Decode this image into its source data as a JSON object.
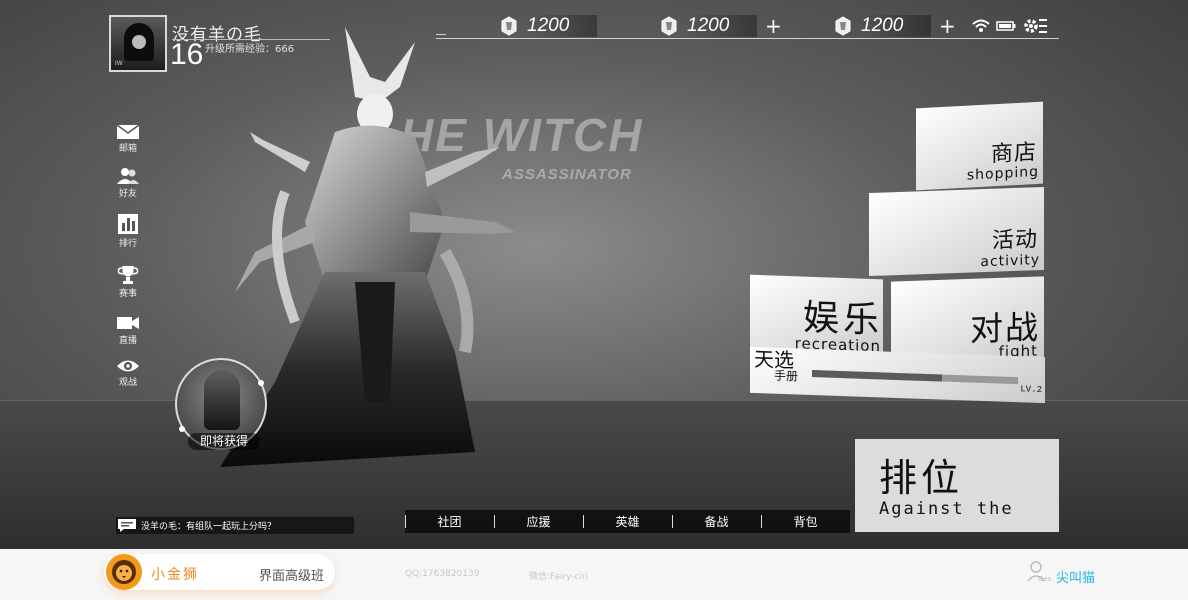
{
  "player": {
    "name": "没有羊の毛",
    "level": "16",
    "exp_label": "升级所需经验：666",
    "avatar_tag": "IW"
  },
  "currencies": [
    {
      "amount": "1200",
      "has_add": false
    },
    {
      "amount": "1200",
      "has_add": true,
      "add_label": "+"
    },
    {
      "amount": "1200",
      "has_add": true,
      "add_label": "+"
    }
  ],
  "system_icons": [
    "wifi-icon",
    "battery-icon",
    "settings-icon"
  ],
  "sidebar": {
    "items": [
      {
        "label": "邮箱",
        "icon": "mail-icon"
      },
      {
        "label": "好友",
        "icon": "friends-icon"
      },
      {
        "label": "排行",
        "icon": "ranking-icon"
      },
      {
        "label": "赛事",
        "icon": "trophy-icon"
      },
      {
        "label": "直播",
        "icon": "live-camera-icon"
      },
      {
        "label": "观战",
        "icon": "eye-icon"
      }
    ]
  },
  "hero": {
    "title": "HE WITCH",
    "subtitle": "ASSASSINATOR"
  },
  "reward": {
    "label": "即将获得"
  },
  "menu": {
    "shop": {
      "cn": "商店",
      "en": "shopping"
    },
    "activity": {
      "cn": "活动",
      "en": "activity"
    },
    "recreation": {
      "cn": "娱乐",
      "en": "recreation"
    },
    "fight": {
      "cn": "对战",
      "en": "fight"
    },
    "pass": {
      "cn_title": "天选",
      "cn_sub": "手册",
      "level": "LV.2",
      "progress": 0.63
    },
    "ranked": {
      "cn": "排位",
      "en": "Against the"
    }
  },
  "bottom_nav": [
    "社团",
    "应援",
    "英雄",
    "备战",
    "背包"
  ],
  "chat": {
    "text": "没羊の毛：有组队一起玩上分吗？"
  },
  "footer": {
    "brand": "小金狮",
    "course": "界面高级班",
    "qq": "QQ:1763820139",
    "wechat": "微信:Fairy-ciri",
    "author_des": "Des",
    "author": "尖叫猫"
  },
  "colors": {
    "brand_orange": "#f08a1c",
    "author_blue": "#29b6e6",
    "panel_light": "#e8e8e8"
  }
}
